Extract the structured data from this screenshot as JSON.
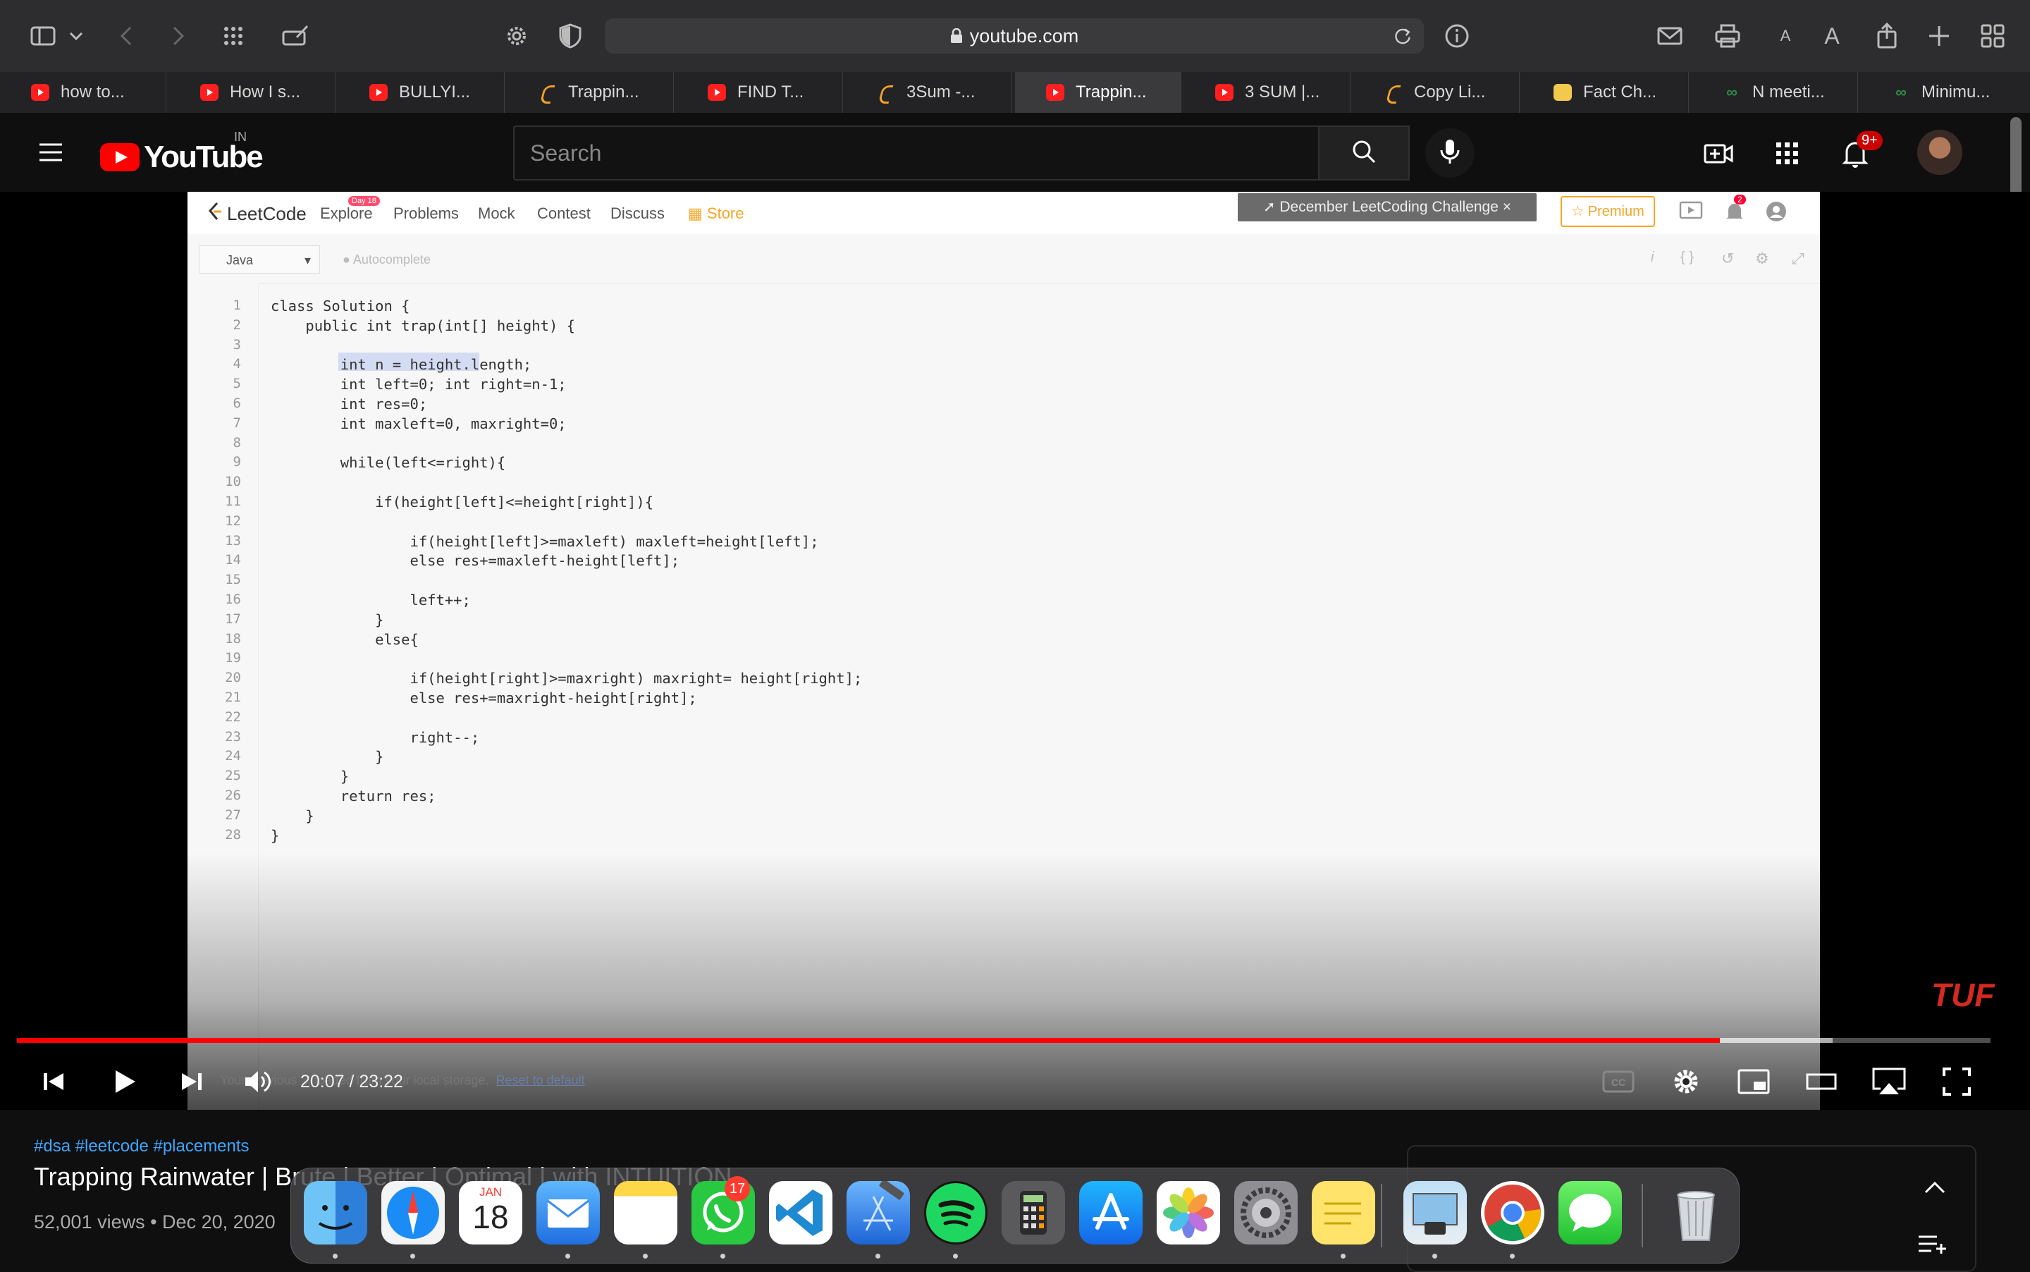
{
  "browser": {
    "url": "youtube.com",
    "tabs": [
      {
        "label": "how to...",
        "favicon": "youtube-icon",
        "active": false
      },
      {
        "label": "How I s...",
        "favicon": "youtube-icon",
        "active": false
      },
      {
        "label": "BULLYI...",
        "favicon": "youtube-icon",
        "active": false
      },
      {
        "label": "Trappin...",
        "favicon": "leetcode-icon",
        "active": false
      },
      {
        "label": "FIND T...",
        "favicon": "youtube-icon",
        "active": false
      },
      {
        "label": "3Sum -...",
        "favicon": "leetcode-icon",
        "active": false
      },
      {
        "label": "Trappin...",
        "favicon": "youtube-icon",
        "active": true
      },
      {
        "label": "3 SUM |...",
        "favicon": "youtube-icon",
        "active": false
      },
      {
        "label": "Copy Li...",
        "favicon": "leetcode-icon",
        "active": false
      },
      {
        "label": "Fact Ch...",
        "favicon": "factcheck-icon",
        "active": false
      },
      {
        "label": "N meeti...",
        "favicon": "gfg-icon",
        "active": false
      },
      {
        "label": "Minimu...",
        "favicon": "gfg-icon",
        "active": false
      }
    ],
    "text_size_small": "A",
    "text_size_large": "A"
  },
  "youtube": {
    "logo_text": "YouTube",
    "country_code": "IN",
    "search_placeholder": "Search",
    "notification_count": "9+"
  },
  "video_frame": {
    "leetcode": {
      "logo": "LeetCode",
      "nav": [
        "Explore",
        "Problems",
        "Mock",
        "Contest",
        "Discuss",
        "Store"
      ],
      "explore_badge": "Day 18",
      "challenge_banner": "December LeetCoding Challenge",
      "premium_label": "Premium",
      "notif_count": "2",
      "language": "Java",
      "autocomplete_label": "Autocomplete"
    },
    "code_lines": [
      "class Solution {",
      "    public int trap(int[] height) {",
      "",
      "        int n = height.length;",
      "        int left=0; int right=n-1;",
      "        int res=0;",
      "        int maxleft=0, maxright=0;",
      "",
      "        while(left<=right){",
      "",
      "            if(height[left]<=height[right]){",
      "",
      "                if(height[left]>=maxleft) maxleft=height[left];",
      "                else res+=maxleft-height[left];",
      "",
      "                left++;",
      "            }",
      "            else{",
      "",
      "                if(height[right]>=maxright) maxright= height[right];",
      "                else res+=maxright-height[right];",
      "",
      "                right--;",
      "            }",
      "        }",
      "        return res;",
      "    }",
      "}"
    ],
    "storage_message": "Your previous ... loaded from your local storage.",
    "reset_link": "Reset to default",
    "watermark": "TUF"
  },
  "player": {
    "time_display": "20:07 / 23:22",
    "played_fraction": 0.863,
    "buffered_fraction": 0.92
  },
  "video_info": {
    "hashtags": "#dsa #leetcode #placements",
    "title": "Trapping Rainwater | Brute | Better | Optimal | with INTUITION",
    "meta": "52,001 views • Dec 20, 2020"
  },
  "dock": {
    "calendar_month": "JAN",
    "calendar_day": "18",
    "whatsapp_badge": "17",
    "apps": [
      "Finder",
      "Safari",
      "Calendar",
      "Mail",
      "Notes",
      "WhatsApp",
      "Visual Studio Code",
      "Xcode",
      "Spotify",
      "Calculator",
      "App Store",
      "Photos",
      "System Preferences",
      "Stickies",
      "Preview",
      "Google Chrome",
      "Messages",
      "Trash"
    ]
  },
  "colors": {
    "youtube_red": "#ff0000",
    "hashtag_blue": "#3ea6ff",
    "leetcode_keyword": "#3b3bd6"
  }
}
